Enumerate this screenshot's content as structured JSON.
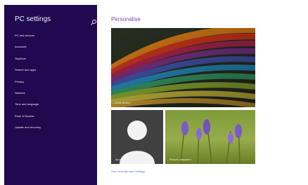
{
  "sidebar": {
    "title": "PC settings",
    "items": [
      "PC and devices",
      "Accounts",
      "SkyDrive",
      "Search and apps",
      "Privacy",
      "Network",
      "Time and language",
      "Ease of Access",
      "Update and recovery"
    ]
  },
  "main": {
    "title": "Personalise",
    "lock_screen_label": "Lock screen",
    "account_picture_label": "Account picture",
    "picture_password_label": "Picture password",
    "footer_link": "View recently used settings"
  },
  "colors": {
    "sidebar_bg": "#20094f",
    "accent": "#7b46b0",
    "link": "#4f6fd0"
  }
}
